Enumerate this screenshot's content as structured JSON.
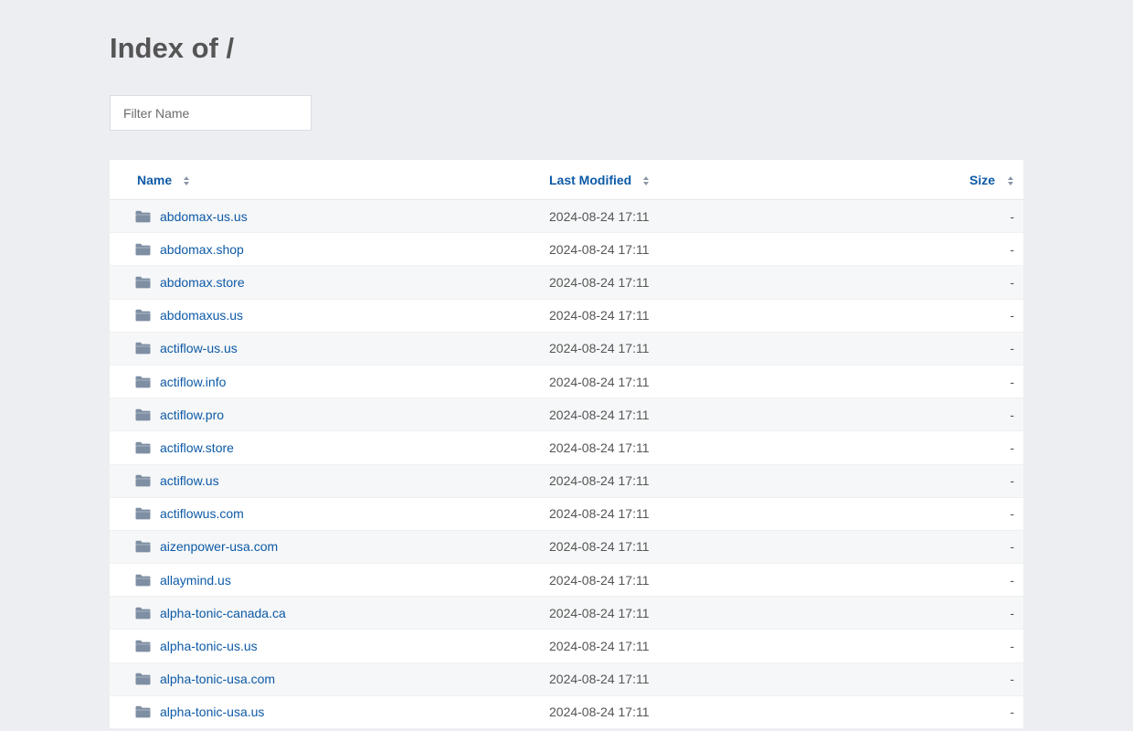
{
  "page": {
    "title": "Index of /",
    "filter_placeholder": "Filter Name"
  },
  "columns": {
    "name": "Name",
    "modified": "Last Modified",
    "size": "Size"
  },
  "colors": {
    "link": "#0d5aa7",
    "background": "#eceef1",
    "folder_icon": "#7e8ea3"
  },
  "entries": [
    {
      "name": "abdomax-us.us",
      "modified": "2024-08-24 17:11",
      "size": "-",
      "icon": "folder-icon"
    },
    {
      "name": "abdomax.shop",
      "modified": "2024-08-24 17:11",
      "size": "-",
      "icon": "folder-icon"
    },
    {
      "name": "abdomax.store",
      "modified": "2024-08-24 17:11",
      "size": "-",
      "icon": "folder-icon"
    },
    {
      "name": "abdomaxus.us",
      "modified": "2024-08-24 17:11",
      "size": "-",
      "icon": "folder-icon"
    },
    {
      "name": "actiflow-us.us",
      "modified": "2024-08-24 17:11",
      "size": "-",
      "icon": "folder-icon"
    },
    {
      "name": "actiflow.info",
      "modified": "2024-08-24 17:11",
      "size": "-",
      "icon": "folder-icon"
    },
    {
      "name": "actiflow.pro",
      "modified": "2024-08-24 17:11",
      "size": "-",
      "icon": "folder-icon"
    },
    {
      "name": "actiflow.store",
      "modified": "2024-08-24 17:11",
      "size": "-",
      "icon": "folder-icon"
    },
    {
      "name": "actiflow.us",
      "modified": "2024-08-24 17:11",
      "size": "-",
      "icon": "folder-icon"
    },
    {
      "name": "actiflowus.com",
      "modified": "2024-08-24 17:11",
      "size": "-",
      "icon": "folder-icon"
    },
    {
      "name": "aizenpower-usa.com",
      "modified": "2024-08-24 17:11",
      "size": "-",
      "icon": "folder-icon"
    },
    {
      "name": "allaymind.us",
      "modified": "2024-08-24 17:11",
      "size": "-",
      "icon": "folder-icon"
    },
    {
      "name": "alpha-tonic-canada.ca",
      "modified": "2024-08-24 17:11",
      "size": "-",
      "icon": "folder-icon"
    },
    {
      "name": "alpha-tonic-us.us",
      "modified": "2024-08-24 17:11",
      "size": "-",
      "icon": "folder-icon"
    },
    {
      "name": "alpha-tonic-usa.com",
      "modified": "2024-08-24 17:11",
      "size": "-",
      "icon": "folder-icon"
    },
    {
      "name": "alpha-tonic-usa.us",
      "modified": "2024-08-24 17:11",
      "size": "-",
      "icon": "folder-icon"
    }
  ]
}
